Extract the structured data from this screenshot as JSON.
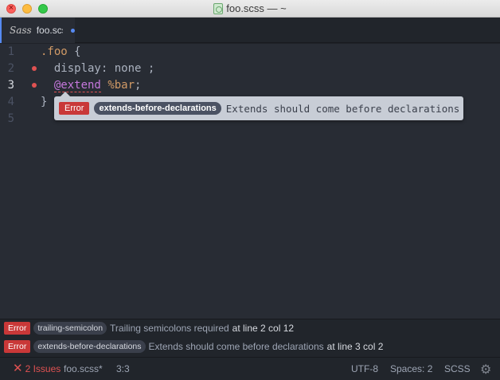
{
  "window": {
    "title": "foo.scss — ~"
  },
  "tabs": [
    {
      "label": "foo.scss",
      "logo": "Sass",
      "modified": true
    }
  ],
  "editor": {
    "lines": [
      {
        "number": "1",
        "sel": ".foo",
        "brace": " {"
      },
      {
        "number": "2",
        "prop": "display",
        "rest": ": none ;"
      },
      {
        "number": "3",
        "atrule": "@extend",
        "space": " ",
        "placeholder": "%bar",
        "semi": ";"
      },
      {
        "number": "4",
        "text": "}"
      },
      {
        "number": "5",
        "text": ""
      }
    ]
  },
  "tooltip": {
    "severity": "Error",
    "rule": "extends-before-declarations",
    "message": "Extends should come before declarations"
  },
  "linter_panel": {
    "items": [
      {
        "severity": "Error",
        "rule": "trailing-semicolon",
        "message": "Trailing semicolons required",
        "location": "at line 2 col 12"
      },
      {
        "severity": "Error",
        "rule": "extends-before-declarations",
        "message": "Extends should come before declarations",
        "location": "at line 3 col 2"
      }
    ]
  },
  "statusbar": {
    "issues": "2 Issues",
    "file": "foo.scss*",
    "cursor": "3:3",
    "encoding": "UTF-8",
    "indent": "Spaces: 2",
    "grammar": "SCSS"
  },
  "colors": {
    "accent": "#568af2",
    "error": "#c93838",
    "editor_bg": "#282c34"
  },
  "icons": [
    "close-icon",
    "minimize-icon",
    "maximize-icon",
    "scss-file-icon",
    "error-x-icon",
    "gear-icon"
  ]
}
